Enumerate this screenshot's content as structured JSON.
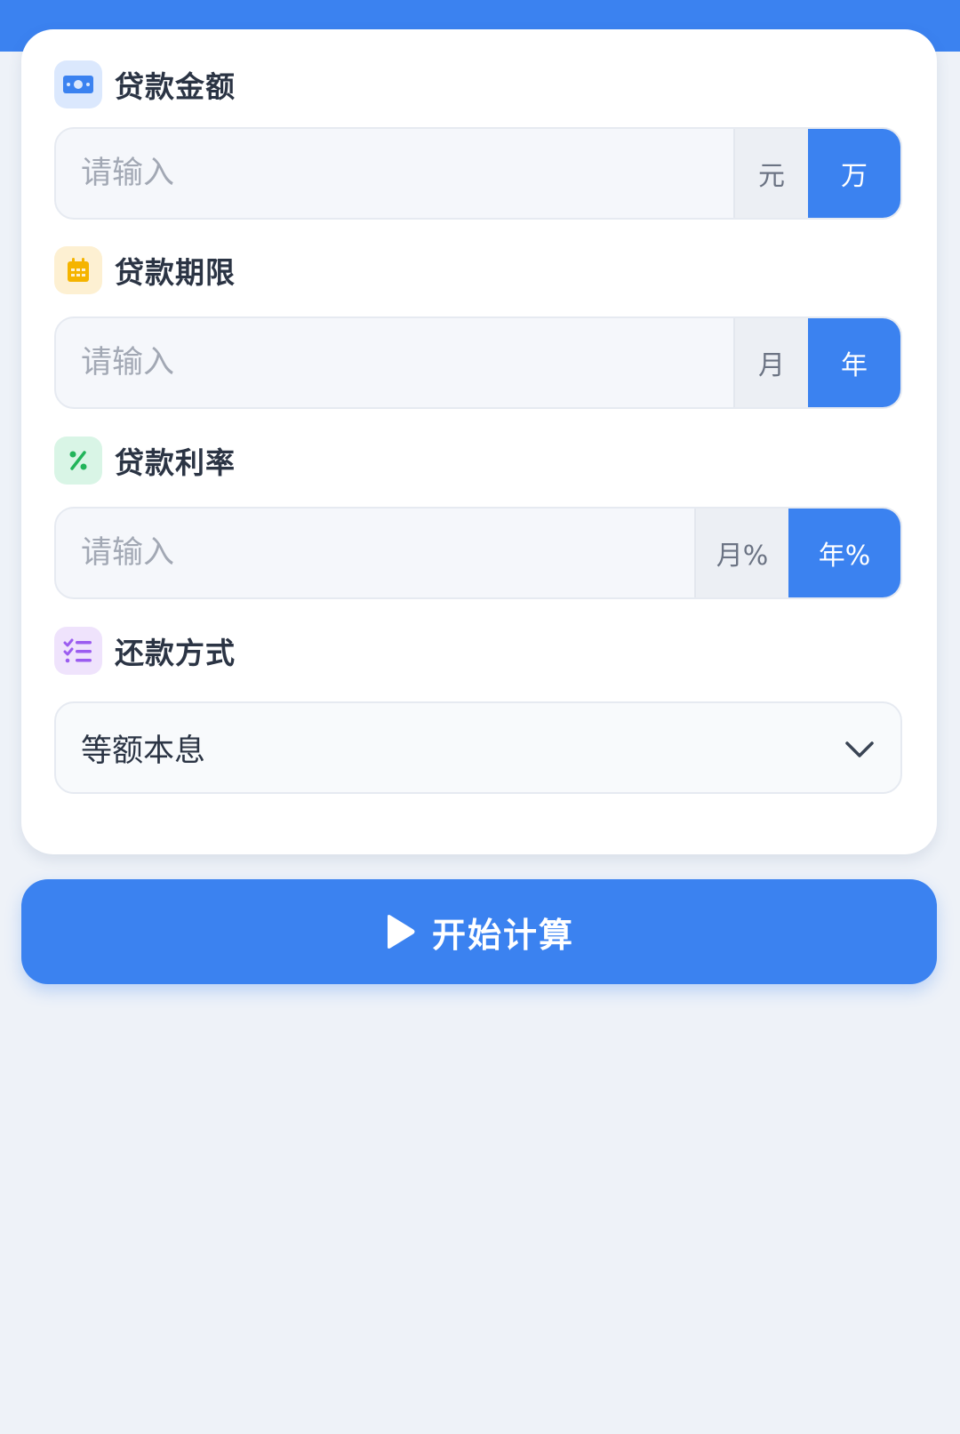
{
  "colors": {
    "primary": "#3b82f0",
    "background": "#eef2f8",
    "card": "#ffffff",
    "amount_icon_bg": "#dbe8fd",
    "term_icon_bg": "#fdf0d2",
    "rate_icon_bg": "#d9f5e6",
    "method_icon_bg": "#efe3fc"
  },
  "form": {
    "amount": {
      "label": "贷款金额",
      "icon": "cash-icon",
      "placeholder": "请输入",
      "value": "",
      "units": [
        "元",
        "万"
      ],
      "selected_unit": "万"
    },
    "term": {
      "label": "贷款期限",
      "icon": "calendar-icon",
      "placeholder": "请输入",
      "value": "",
      "units": [
        "月",
        "年"
      ],
      "selected_unit": "年"
    },
    "rate": {
      "label": "贷款利率",
      "icon": "percent-icon",
      "placeholder": "请输入",
      "value": "",
      "units": [
        "月%",
        "年%"
      ],
      "selected_unit": "年%"
    },
    "method": {
      "label": "还款方式",
      "icon": "list-check-icon",
      "selected_value": "等额本息"
    }
  },
  "actions": {
    "start_label": "开始计算",
    "start_icon": "play-icon"
  }
}
